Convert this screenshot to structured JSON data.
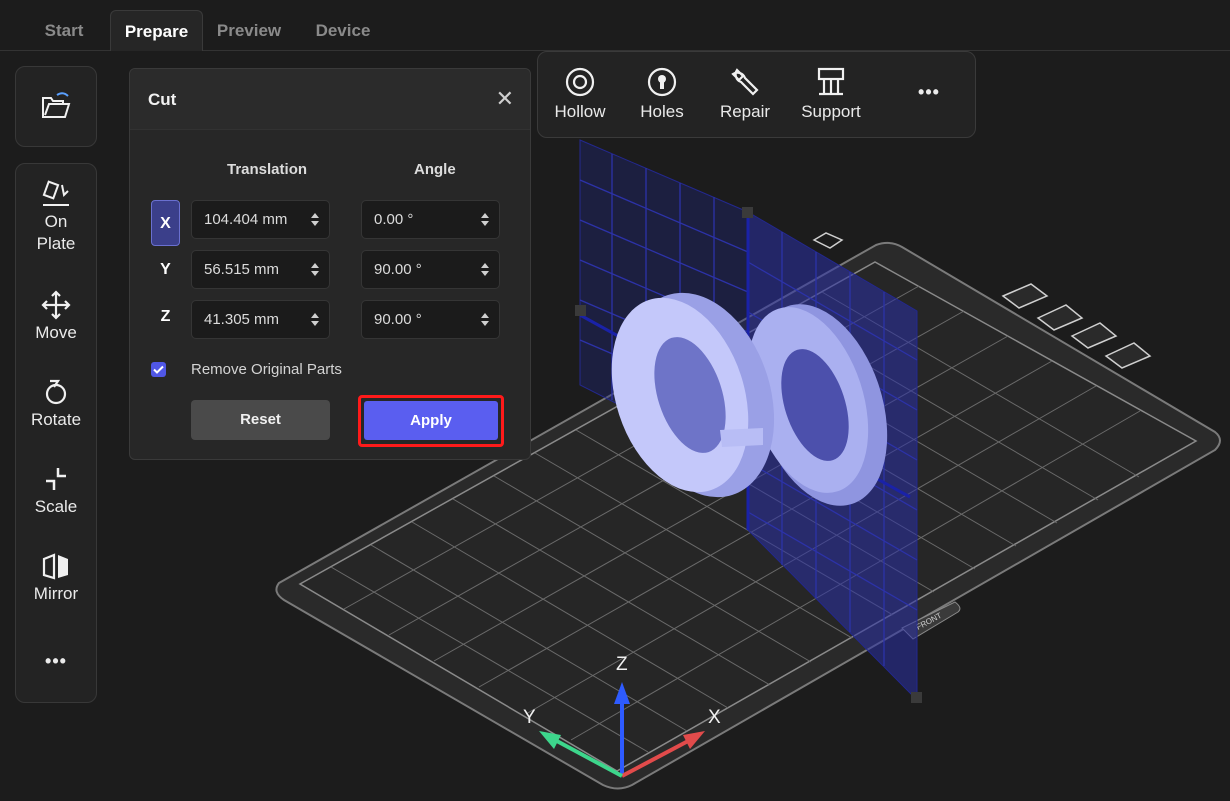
{
  "tabs": [
    {
      "label": "Start",
      "active": false
    },
    {
      "label": "Prepare",
      "active": true
    },
    {
      "label": "Preview",
      "active": false
    },
    {
      "label": "Device",
      "active": false
    }
  ],
  "left_toolbar": {
    "open_icon": "folder-open-icon",
    "items": [
      {
        "label_line1": "On",
        "label_line2": "Plate",
        "icon": "on-plate-icon"
      },
      {
        "label_line1": "Move",
        "label_line2": "",
        "icon": "move-icon"
      },
      {
        "label_line1": "Rotate",
        "label_line2": "",
        "icon": "rotate-icon"
      },
      {
        "label_line1": "Scale",
        "label_line2": "",
        "icon": "scale-icon"
      },
      {
        "label_line1": "Mirror",
        "label_line2": "",
        "icon": "mirror-icon"
      }
    ],
    "more_label": "•••"
  },
  "top_toolbar": {
    "items": [
      {
        "label": "Hollow",
        "icon": "hollow-icon"
      },
      {
        "label": "Holes",
        "icon": "holes-icon"
      },
      {
        "label": "Repair",
        "icon": "repair-wrench-icon"
      },
      {
        "label": "Support",
        "icon": "support-icon"
      }
    ],
    "more_label": "•••"
  },
  "cut_panel": {
    "title": "Cut",
    "close": "✕",
    "translation_header": "Translation",
    "angle_header": "Angle",
    "rows": [
      {
        "axis": "X",
        "translation": "104.404 mm",
        "angle": "0.00 °",
        "active": true
      },
      {
        "axis": "Y",
        "translation": "56.515 mm",
        "angle": "90.00 °",
        "active": false
      },
      {
        "axis": "Z",
        "translation": "41.305 mm",
        "angle": "90.00 °",
        "active": false
      }
    ],
    "remove_original_label": "Remove Original Parts",
    "remove_original_checked": true,
    "reset_label": "Reset",
    "apply_label": "Apply"
  },
  "viewport": {
    "axis_labels": {
      "z": "Z",
      "y": "Y",
      "x": "X"
    },
    "plate_label": "FRONT",
    "colors": {
      "x_axis": "#e24b4b",
      "y_axis": "#3dd68c",
      "z_axis": "#2e5bff",
      "model": "#b8bdf5",
      "cut_plane": "#1a1f8c"
    }
  }
}
